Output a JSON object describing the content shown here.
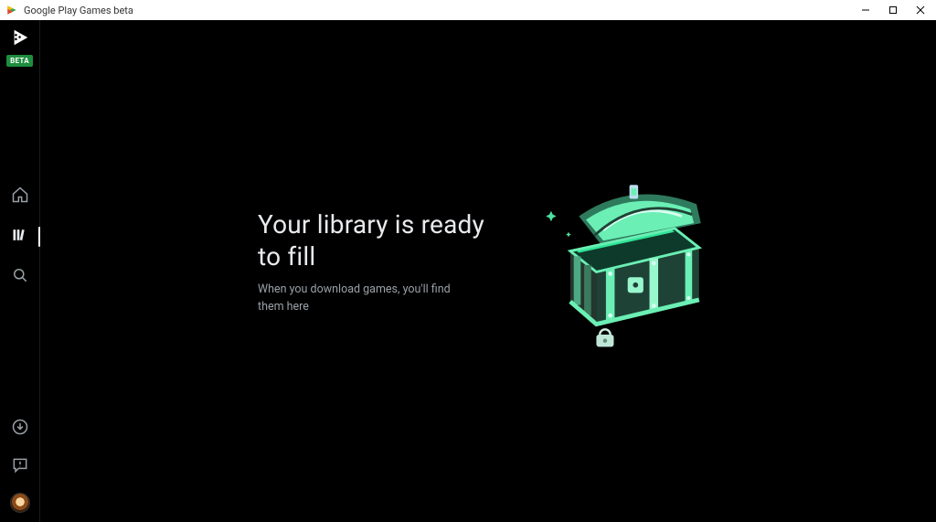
{
  "window": {
    "title": "Google Play Games beta"
  },
  "sidebar": {
    "badge": "BETA",
    "nav": {
      "home": "Home",
      "library": "Library",
      "search": "Search"
    },
    "bottom": {
      "downloads": "Downloads",
      "feedback": "Feedback",
      "profile": "Profile"
    }
  },
  "main": {
    "empty": {
      "heading": "Your library is ready to fill",
      "subtext": "When you download games, you'll find them here"
    }
  },
  "colors": {
    "accent": "#1e8e3e",
    "chest_light": "#6befb4",
    "chest_dark": "#1f4236"
  }
}
